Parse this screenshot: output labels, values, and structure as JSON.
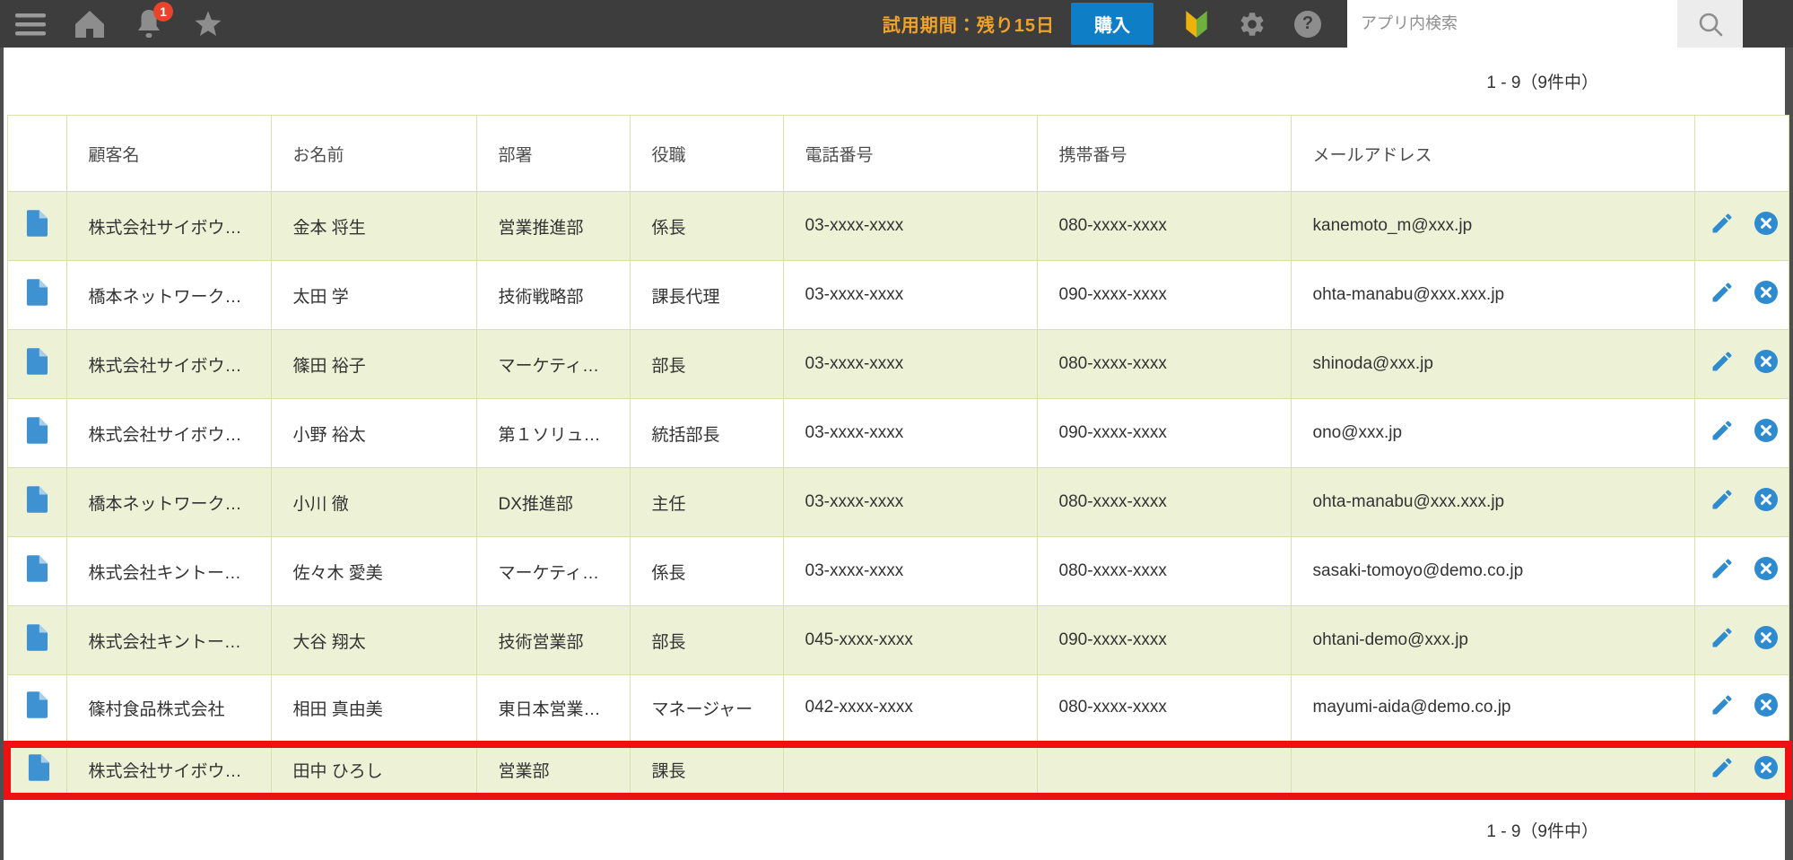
{
  "topbar": {
    "notification_badge": "1",
    "trial_label": "試用期間：残り15日",
    "buy_label": "購入",
    "search_placeholder": "アプリ内検索"
  },
  "pagination": {
    "top": "1 - 9（9件中）",
    "bottom": "1 - 9（9件中）"
  },
  "table": {
    "headers": [
      "顧客名",
      "お名前",
      "部署",
      "役職",
      "電話番号",
      "携帯番号",
      "メールアドレス"
    ],
    "rows": [
      {
        "customer": "株式会社サイボウ…",
        "name": "金本 将生",
        "dept": "営業推進部",
        "title": "係長",
        "phone": "03-xxxx-xxxx",
        "mobile": "080-xxxx-xxxx",
        "email": "kanemoto_m@xxx.jp",
        "highlighted": false
      },
      {
        "customer": "橋本ネットワーク…",
        "name": "太田 学",
        "dept": "技術戦略部",
        "title": "課長代理",
        "phone": "03-xxxx-xxxx",
        "mobile": "090-xxxx-xxxx",
        "email": "ohta-manabu@xxx.xxx.jp",
        "highlighted": false
      },
      {
        "customer": "株式会社サイボウ…",
        "name": "篠田 裕子",
        "dept": "マーケティ…",
        "title": "部長",
        "phone": "03-xxxx-xxxx",
        "mobile": "080-xxxx-xxxx",
        "email": "shinoda@xxx.jp",
        "highlighted": false
      },
      {
        "customer": "株式会社サイボウ…",
        "name": "小野 裕太",
        "dept": "第１ソリュ…",
        "title": "統括部長",
        "phone": "03-xxxx-xxxx",
        "mobile": "090-xxxx-xxxx",
        "email": "ono@xxx.jp",
        "highlighted": false
      },
      {
        "customer": "橋本ネットワーク…",
        "name": "小川 徹",
        "dept": "DX推進部",
        "title": "主任",
        "phone": "03-xxxx-xxxx",
        "mobile": "080-xxxx-xxxx",
        "email": "ohta-manabu@xxx.xxx.jp",
        "highlighted": false
      },
      {
        "customer": "株式会社キントー…",
        "name": "佐々木 愛美",
        "dept": "マーケティ…",
        "title": "係長",
        "phone": "03-xxxx-xxxx",
        "mobile": "080-xxxx-xxxx",
        "email": "sasaki-tomoyo@demo.co.jp",
        "highlighted": false
      },
      {
        "customer": "株式会社キントー…",
        "name": "大谷 翔太",
        "dept": "技術営業部",
        "title": "部長",
        "phone": "045-xxxx-xxxx",
        "mobile": "090-xxxx-xxxx",
        "email": "ohtani-demo@xxx.jp",
        "highlighted": false
      },
      {
        "customer": "篠村食品株式会社",
        "name": "相田 真由美",
        "dept": "東日本営業…",
        "title": "マネージャー",
        "phone": "042-xxxx-xxxx",
        "mobile": "080-xxxx-xxxx",
        "email": "mayumi-aida@demo.co.jp",
        "highlighted": false
      },
      {
        "customer": "株式会社サイボウ…",
        "name": "田中 ひろし",
        "dept": "営業部",
        "title": "課長",
        "phone": "",
        "mobile": "",
        "email": "",
        "highlighted": true
      }
    ]
  },
  "icons": {
    "topbar": [
      "hamburger-icon",
      "home-icon",
      "bell-icon",
      "star-icon",
      "beginner-mark-icon",
      "gear-icon",
      "help-icon",
      "search-icon"
    ],
    "row": [
      "document-icon",
      "pencil-icon",
      "x-circle-icon"
    ]
  },
  "colors": {
    "topbar_bg": "#3d3d3d",
    "trial_orange": "#f0a128",
    "buy_button_blue": "#0e7ec6",
    "badge_red": "#e8432d",
    "row_green": "#edf2d7",
    "table_border_green": "#d8e1ae",
    "link_blue": "#4293d4",
    "action_icon_blue": "#2e8bd0",
    "highlight_red": "#ee1111"
  }
}
